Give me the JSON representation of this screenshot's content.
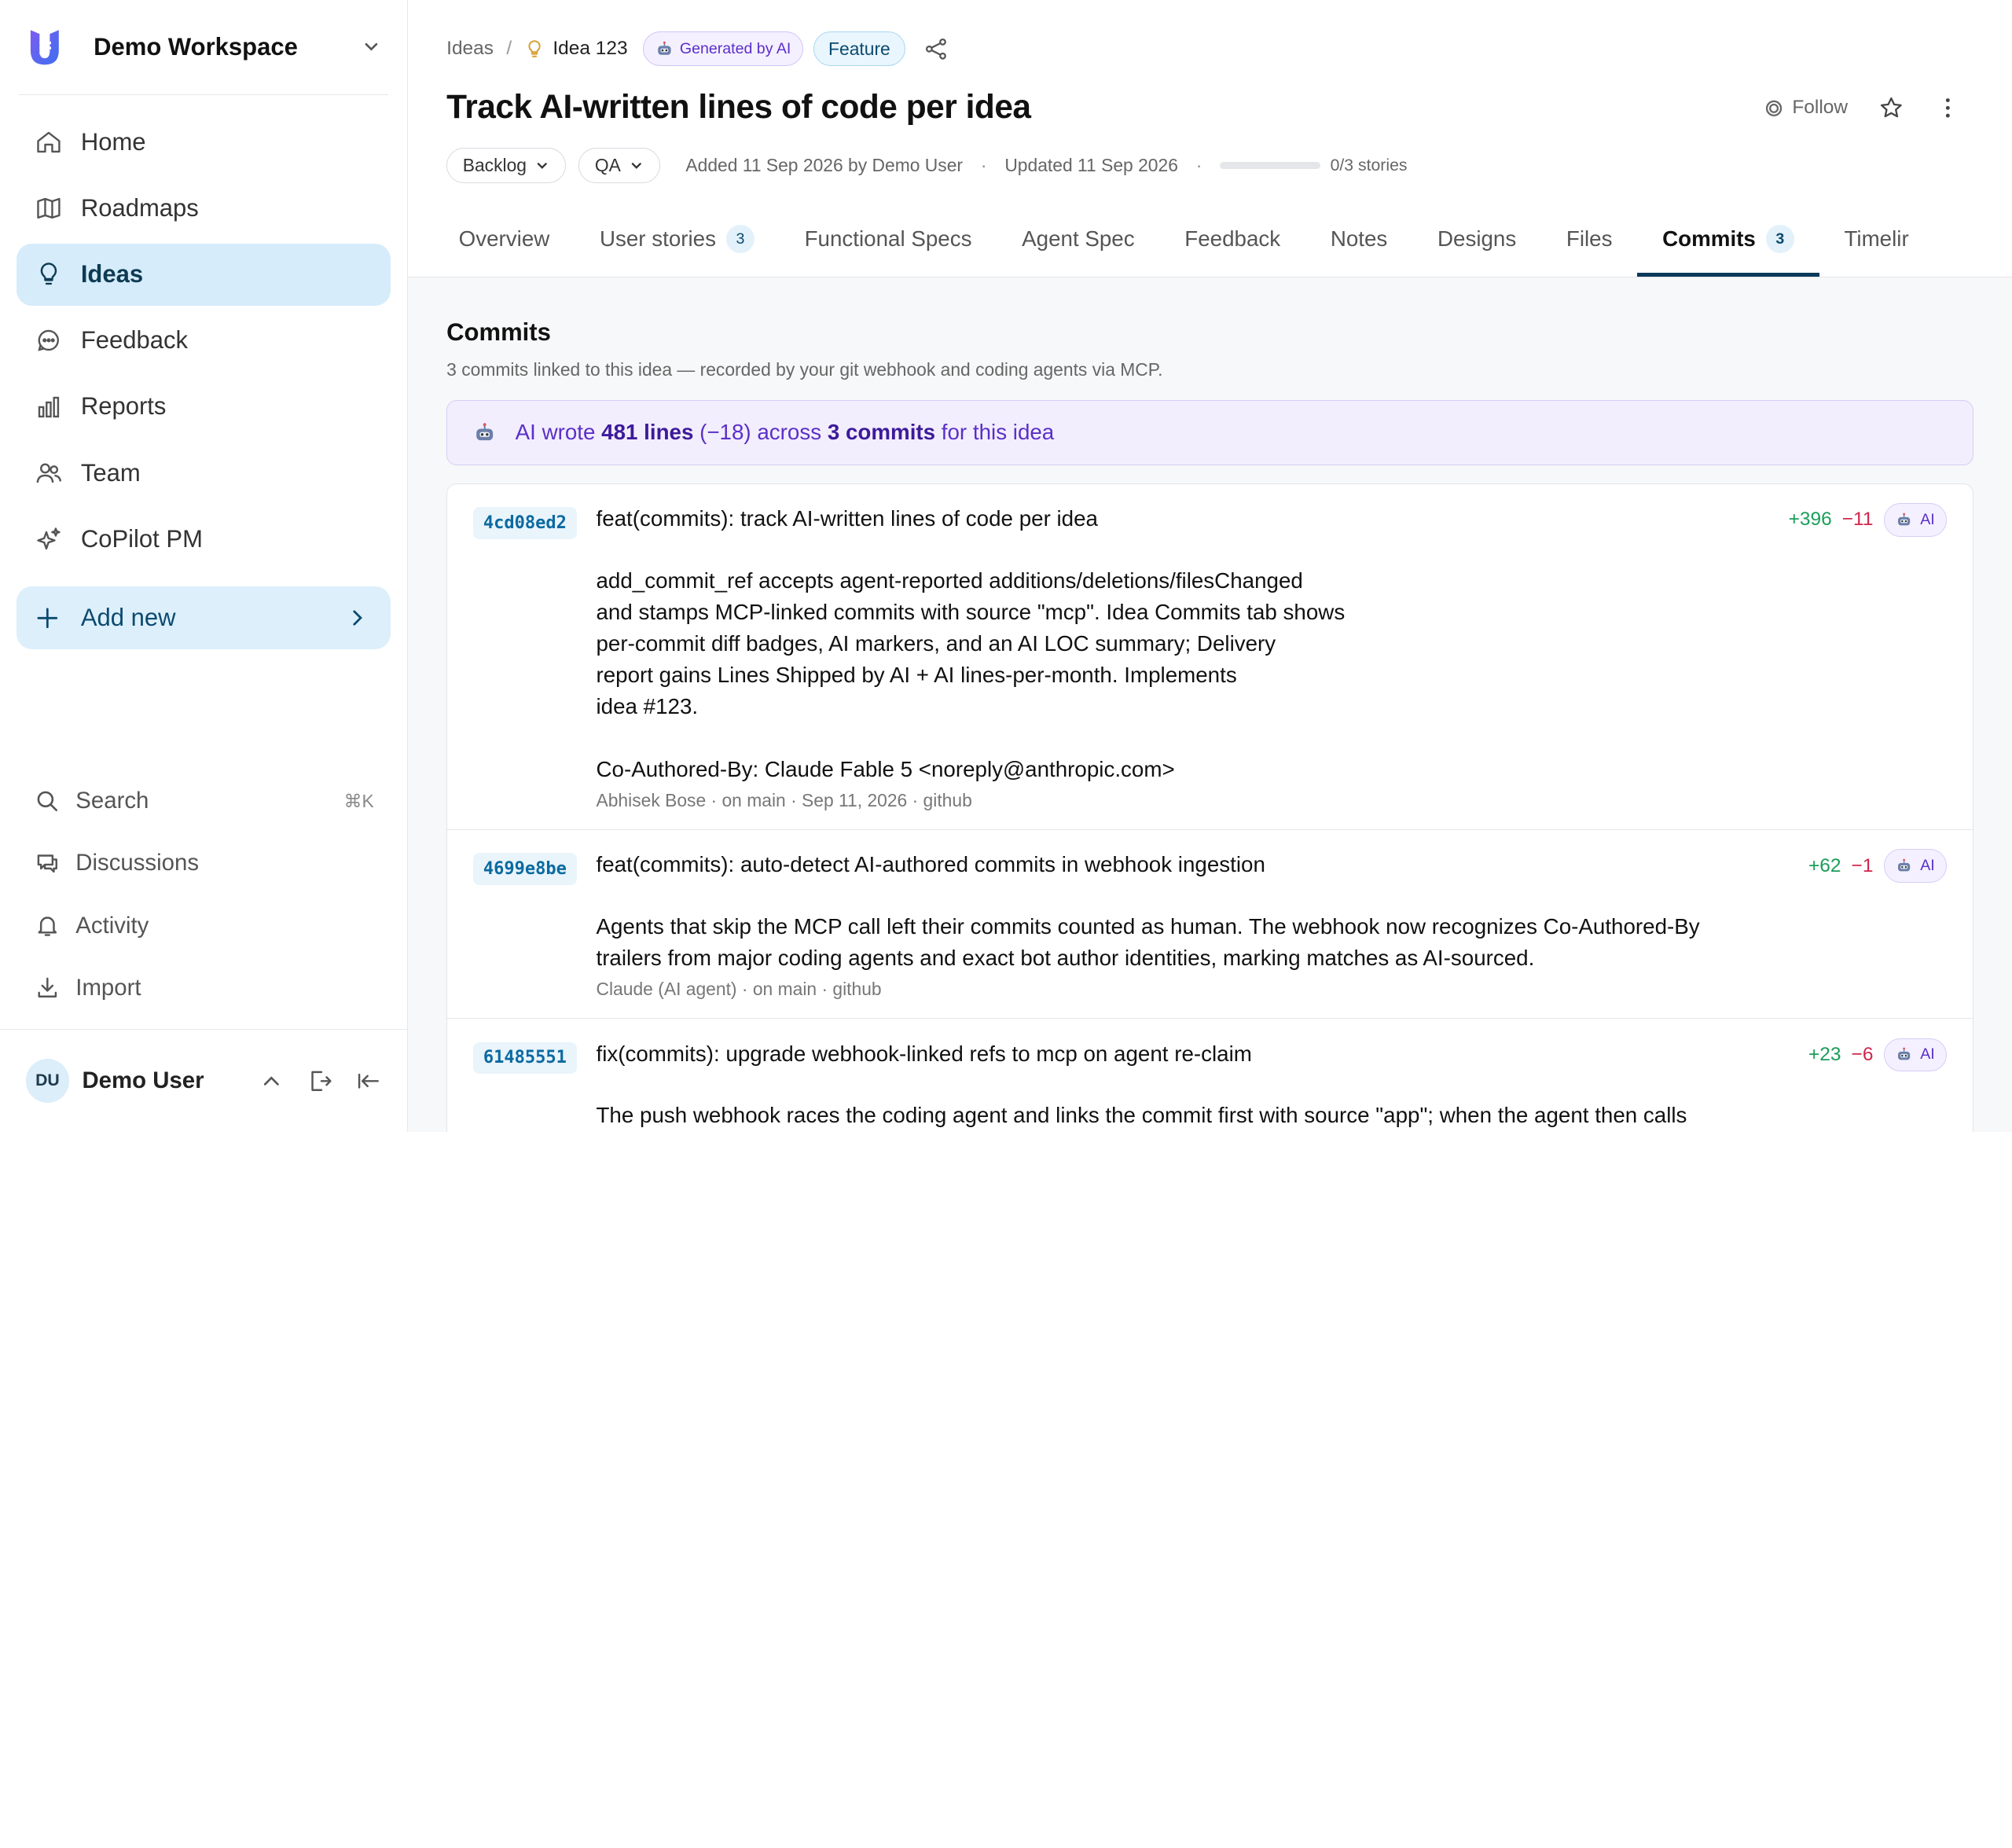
{
  "workspace": {
    "name": "Demo Workspace"
  },
  "nav": {
    "items": [
      {
        "label": "Home"
      },
      {
        "label": "Roadmaps"
      },
      {
        "label": "Ideas"
      },
      {
        "label": "Feedback"
      },
      {
        "label": "Reports"
      },
      {
        "label": "Team"
      },
      {
        "label": "CoPilot PM"
      }
    ],
    "add_new": "Add new"
  },
  "bottom_nav": {
    "search": "Search",
    "search_shortcut": "⌘K",
    "discussions": "Discussions",
    "activity": "Activity",
    "import": "Import"
  },
  "user": {
    "initials": "DU",
    "name": "Demo User"
  },
  "breadcrumb": {
    "parent": "Ideas",
    "separator": "/",
    "current": "Idea 123",
    "ai_badge": "Generated by AI",
    "type_badge": "Feature"
  },
  "header": {
    "title": "Track AI-written lines of code per idea",
    "follow": "Follow",
    "status": "Backlog",
    "stage": "QA",
    "added": "Added 11 Sep 2026 by Demo User",
    "updated": "Updated 11 Sep 2026",
    "stories_progress": 0,
    "stories": "0/3 stories"
  },
  "tabs": [
    {
      "label": "Overview"
    },
    {
      "label": "User stories",
      "count": "3"
    },
    {
      "label": "Functional Specs"
    },
    {
      "label": "Agent Spec"
    },
    {
      "label": "Feedback"
    },
    {
      "label": "Notes"
    },
    {
      "label": "Designs"
    },
    {
      "label": "Files"
    },
    {
      "label": "Commits",
      "count": "3"
    },
    {
      "label": "Timelir"
    }
  ],
  "commits_section": {
    "title": "Commits",
    "subtitle": "3 commits linked to this idea — recorded by your git webhook and coding agents via MCP.",
    "banner": {
      "prefix": "AI wrote ",
      "lines": "481 lines",
      "mid": " (−18) across ",
      "commits": "3 commits",
      "suffix": " for this idea"
    }
  },
  "commits": [
    {
      "sha": "4cd08ed2",
      "subject": "feat(commits): track AI-written lines of code per idea",
      "message": "add_commit_ref accepts agent-reported additions/deletions/filesChanged\nand stamps MCP-linked commits with source \"mcp\". Idea Commits tab shows\nper-commit diff badges, AI markers, and an AI LOC summary; Delivery\nreport gains Lines Shipped by AI + AI lines-per-month. Implements\nidea #123.\n\nCo-Authored-By: Claude Fable 5 <noreply@anthropic.com>",
      "meta": "Abhisek Bose · on main · Sep 11, 2026 · github",
      "additions": "+396",
      "deletions": "−11",
      "ai": "AI"
    },
    {
      "sha": "4699e8be",
      "subject": "feat(commits): auto-detect AI-authored commits in webhook ingestion",
      "message": "Agents that skip the MCP call left their commits counted as human. The webhook now recognizes Co-Authored-By\ntrailers from major coding agents and exact bot author identities, marking matches as AI-sourced.",
      "meta": "Claude (AI agent) · on main · github",
      "additions": "+62",
      "deletions": "−1",
      "ai": "AI"
    },
    {
      "sha": "61485551",
      "subject": "fix(commits): upgrade webhook-linked refs to mcp on agent re-claim",
      "message": "The push webhook races the coding agent and links the commit first with source \"app\"; when the agent then calls",
      "meta": "",
      "additions": "+23",
      "deletions": "−6",
      "ai": "AI"
    }
  ]
}
